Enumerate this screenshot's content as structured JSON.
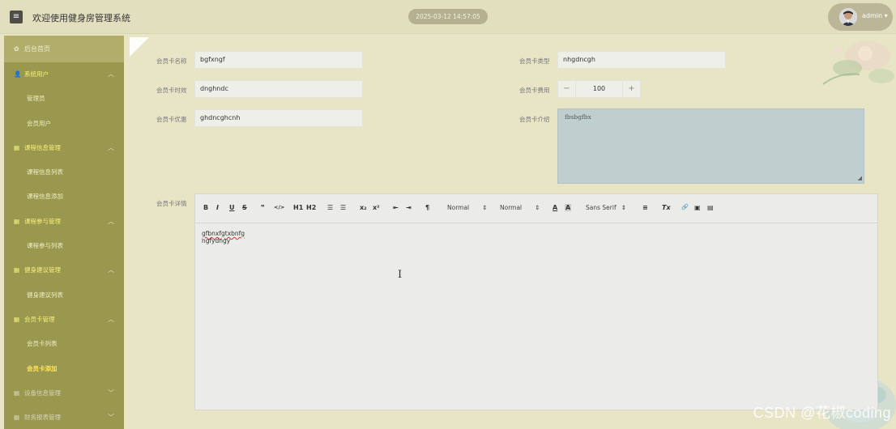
{
  "header": {
    "menu_icon": "hamburger-icon",
    "title": "欢迎使用健身房管理系统",
    "datetime": "2025-03-12 14:57:05",
    "username": "admin"
  },
  "sidebar": {
    "home": "后台首页",
    "groups": [
      {
        "label": "系统用户",
        "items": [
          "管理员",
          "会员用户"
        ]
      },
      {
        "label": "课程信息管理",
        "items": [
          "课程信息列表",
          "课程信息添加"
        ]
      },
      {
        "label": "课程参与管理",
        "items": [
          "课程参与列表"
        ]
      },
      {
        "label": "健身建议管理",
        "items": [
          "健身建议列表"
        ]
      },
      {
        "label": "会员卡管理",
        "items": [
          "会员卡列表",
          "会员卡添加"
        ]
      },
      {
        "label": "设备信息管理",
        "items": []
      },
      {
        "label": "财务报表管理",
        "items": []
      }
    ],
    "active_item": "会员卡添加"
  },
  "form": {
    "card_name": {
      "label": "会员卡名称",
      "value": "bgfxngf"
    },
    "card_type": {
      "label": "会员卡类型",
      "value": "nhgdncgh"
    },
    "card_duration": {
      "label": "会员卡时效",
      "value": "dnghndc"
    },
    "card_fee": {
      "label": "会员卡费用",
      "value": "100",
      "minus": "−",
      "plus": "+"
    },
    "card_discount": {
      "label": "会员卡优惠",
      "value": "ghdncghcnh"
    },
    "card_intro": {
      "label": "会员卡介绍",
      "value": "fbsbgfbx"
    },
    "card_detail": {
      "label": "会员卡详情",
      "lines": [
        "gfbnxfgtxbnfg",
        "ngfydngy"
      ]
    }
  },
  "toolbar": {
    "bold": "B",
    "italic": "I",
    "underline": "U",
    "strike": "S",
    "quote": "❞",
    "code": "</>",
    "h1": "H1",
    "h2": "H2",
    "ol": "☰",
    "ul": "☰",
    "sub": "x₂",
    "sup": "x²",
    "indent_out": "⇤",
    "indent_in": "⇥",
    "direction": "¶",
    "size_select": "Normal",
    "header_select": "Normal",
    "font_color": "A",
    "background": "A",
    "font_select": "Sans Serif",
    "align": "≡",
    "clean": "Tx",
    "link": "🔗",
    "image": "▣",
    "video": "▤"
  },
  "watermark": "CSDN @花椒coding"
}
